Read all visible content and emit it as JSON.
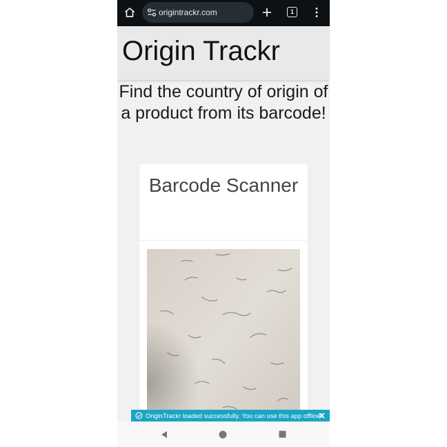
{
  "browser": {
    "url": "origintrackr.com",
    "tab_count": "1",
    "icons": [
      "home-icon",
      "site-settings-icon",
      "plus-icon",
      "tab-switcher-icon",
      "more-vertical-icon"
    ]
  },
  "header": {
    "title": "Origin Trackr"
  },
  "main": {
    "tagline": "Find the country of origin of a product from its barcode!",
    "scanner_card": {
      "title": "Barcode Scanner"
    }
  },
  "toast": {
    "message": "OriginTrackr loaded successfully. You can use this app offline!",
    "color": "#1aa5c4"
  },
  "navbar": {
    "icons": [
      "back-icon",
      "home-circle-icon",
      "recents-icon"
    ]
  }
}
